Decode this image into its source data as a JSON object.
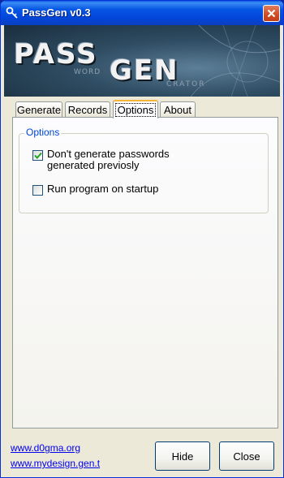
{
  "window": {
    "title": "PassGen v0.3"
  },
  "banner": {
    "logo_pass": "PASS",
    "logo_gen": "GEN",
    "logo_word": "WORD",
    "logo_creator": "CRATOR"
  },
  "tabs": [
    {
      "label": "Generate",
      "active": false
    },
    {
      "label": "Records",
      "active": false
    },
    {
      "label": "Options",
      "active": true
    },
    {
      "label": "About",
      "active": false
    }
  ],
  "options": {
    "group_title": "Options",
    "checkboxes": [
      {
        "label": "Don't generate passwords generated previosly",
        "checked": true
      },
      {
        "label": "Run program on startup",
        "checked": false
      }
    ]
  },
  "footer": {
    "links": [
      "www.d0gma.org",
      "www.mydesign.gen.t"
    ],
    "hide_label": "Hide",
    "close_label": "Close"
  },
  "colors": {
    "titlebar": "#0346da",
    "group_title": "#0046d5",
    "link": "#0000ee",
    "check_mark": "#21a121"
  }
}
